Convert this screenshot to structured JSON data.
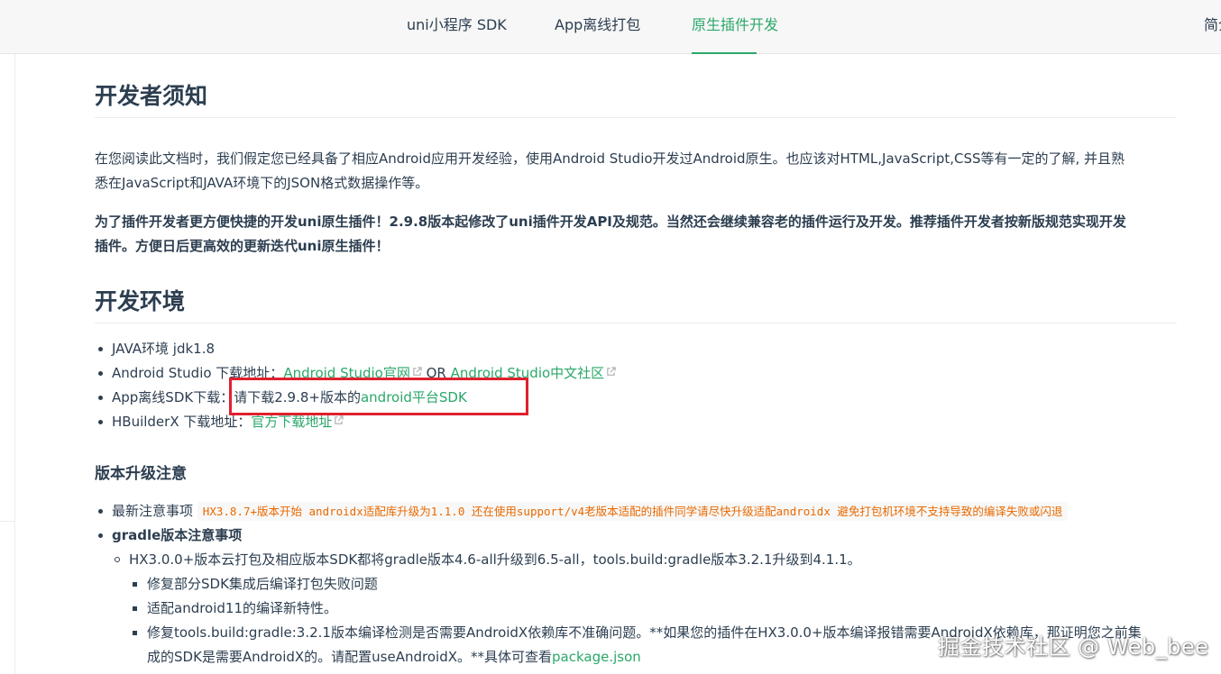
{
  "nav": {
    "items": [
      {
        "label": "uni小程序 SDK",
        "active": false
      },
      {
        "label": "App离线打包",
        "active": false
      },
      {
        "label": "原生插件开发",
        "active": true
      },
      {
        "label": "简介",
        "active": false
      }
    ]
  },
  "notice": {
    "heading": "开发者须知",
    "para1_line1": "在您阅读此文档时，我们假定您已经具备了相应Android应用开发经验，使用Android Studio开发过Android原生。也应该对HTML,JavaScript,CSS等有一定的了解, 并且熟",
    "para1_line2": "悉在JavaScript和JAVA环境下的JSON格式数据操作等。",
    "para2_line1": "为了插件开发者更方便快捷的开发uni原生插件！2.9.8版本起修改了uni插件开发API及规范。当然还会继续兼容老的插件运行及开发。推荐插件开发者按新版规范实现开发",
    "para2_line2": "插件。方便日后更高效的更新迭代uni原生插件！"
  },
  "env": {
    "heading": "开发环境",
    "java": "JAVA环境 jdk1.8",
    "studio_prefix": "Android Studio 下载地址：",
    "studio_link1": "Android Studio官网",
    "studio_or": " OR ",
    "studio_link2": "Android Studio中文社区",
    "sdk_prefix": "App离线SDK下载：",
    "sdk_text": "请下载2.9.8+版本的",
    "sdk_link": "android平台SDK",
    "hbx_prefix": "HBuilderX 下载地址：",
    "hbx_link": "官方下载地址"
  },
  "upgrade": {
    "heading": "版本升级注意",
    "latest_prefix": "最新注意事项",
    "latest_code": "HX3.8.7+版本开始 androidx适配库升级为1.1.0 还在使用support/v4老版本适配的插件同学请尽快升级适配androidx 避免打包机环境不支持导致的编译失败或闪退",
    "gradle_title": "gradle版本注意事项",
    "gradle_item": "HX3.0.0+版本云打包及相应版本SDK都将gradle版本4.6-all升级到6.5-all，tools.build:gradle版本3.2.1升级到4.1.1。",
    "fix1": "修复部分SDK集成后编译打包失败问题",
    "fix2": "适配android11的编译新特性。",
    "fix3_line1": "修复tools.build:gradle:3.2.1版本编译检测是否需要AndroidX依赖库不准确问题。**如果您的插件在HX3.0.0+版本编译报错需要AndroidX依赖库，那证明您之前集",
    "fix3_line2_prefix": "成的SDK是需要AndroidX的。请配置useAndroidX。**具体可查看",
    "fix3_link": "package.json"
  },
  "watermark": "掘金技术社区 @ Web_bee",
  "colors": {
    "accent": "#2aa869",
    "highlight": "#e0202e",
    "code": "#e96900"
  }
}
